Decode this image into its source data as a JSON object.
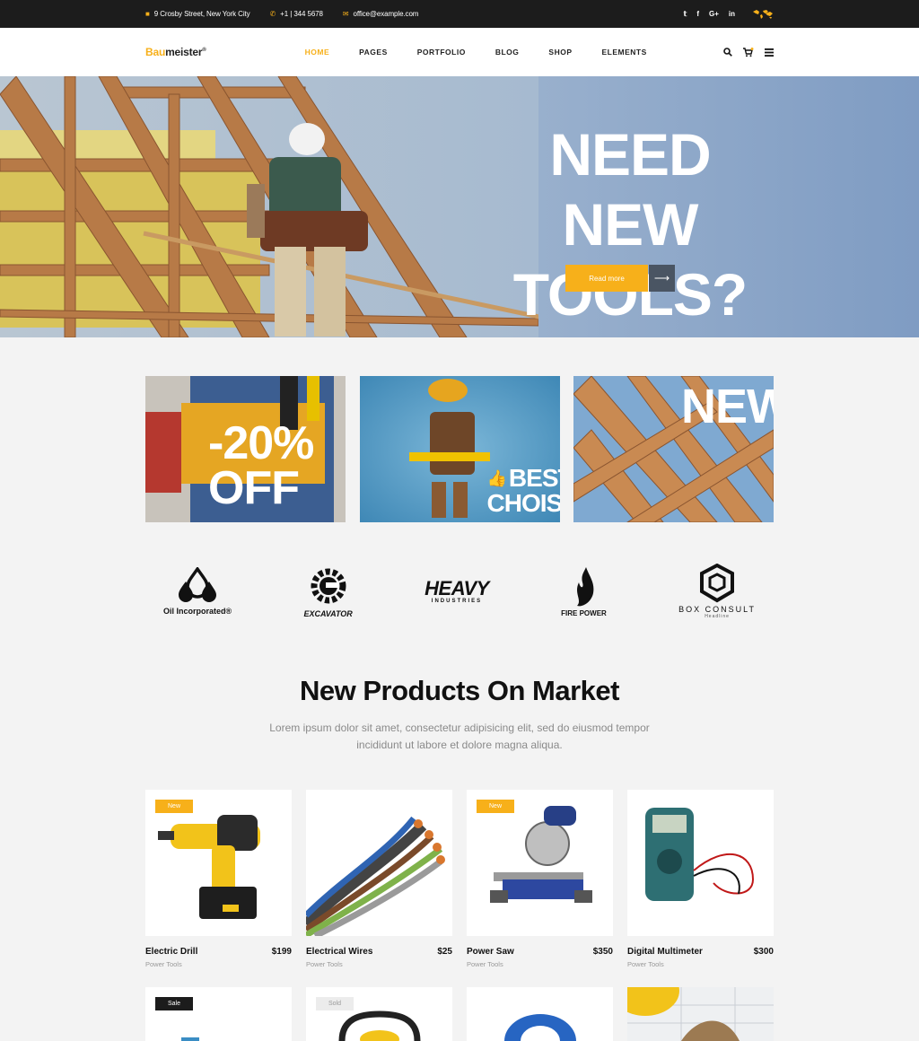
{
  "topbar": {
    "address": "9 Crosby Street, New York City",
    "phone": "+1 | 344 5678",
    "email": "office@example.com",
    "social": [
      "twitter-icon",
      "facebook-icon",
      "google-plus-icon",
      "linkedin-icon"
    ]
  },
  "header": {
    "logo_a": "Bau",
    "logo_b": "meister",
    "logo_mark": "®",
    "nav": [
      "HOME",
      "PAGES",
      "PORTFOLIO",
      "BLOG",
      "SHOP",
      "ELEMENTS"
    ],
    "active_nav": "HOME"
  },
  "hero": {
    "title_line1": "NEED",
    "title_line2": "NEW TOOLS?",
    "button_label": "Read more"
  },
  "promos": [
    {
      "line1": "-20%",
      "line2": "OFF"
    },
    {
      "line1": "BEST",
      "line2": "CHOISE"
    },
    {
      "line1": "NEW"
    }
  ],
  "brands": [
    {
      "label": "Oil Incorporated®"
    },
    {
      "label": "EXCAVATOR"
    },
    {
      "label": "HEAVY",
      "sub": "INDUSTRIES"
    },
    {
      "label": "FIRE POWER"
    },
    {
      "label": "BOX CONSULT",
      "sub": "Headline"
    }
  ],
  "section": {
    "title": "New Products On Market",
    "subtitle": "Lorem ipsum dolor sit amet, consectetur adipisicing elit, sed do eiusmod tempor incididunt ut labore et dolore magna aliqua."
  },
  "products": [
    {
      "name": "Electric Drill",
      "price": "$199",
      "category": "Power Tools",
      "badge": "New"
    },
    {
      "name": "Electrical Wires",
      "price": "$25",
      "category": "Power Tools",
      "badge": ""
    },
    {
      "name": "Power Saw",
      "price": "$350",
      "category": "Power Tools",
      "badge": "New"
    },
    {
      "name": "Digital Multimeter",
      "price": "$300",
      "category": "Power Tools",
      "badge": ""
    }
  ],
  "products_row2": [
    {
      "badge": "Sale"
    },
    {
      "badge": "Sold"
    },
    {
      "badge": ""
    },
    {
      "badge": ""
    }
  ],
  "colors": {
    "accent": "#f7b01a",
    "dark": "#1c1c1c",
    "background": "#f3f3f3"
  }
}
